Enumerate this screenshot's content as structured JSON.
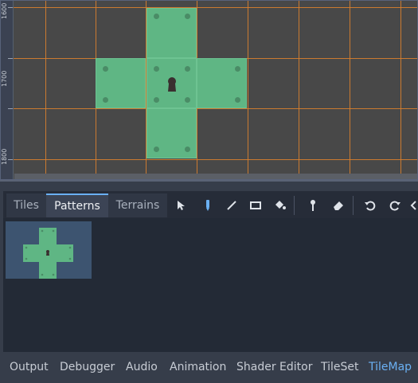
{
  "viewport": {
    "ruler_labels": [
      "1600",
      "1700",
      "1800"
    ]
  },
  "pattern_panel": {
    "tabs": [
      {
        "label": "Tiles",
        "active": false
      },
      {
        "label": "Patterns",
        "active": true
      },
      {
        "label": "Terrains",
        "active": false
      }
    ],
    "tools": [
      {
        "name": "select-tool",
        "icon": "arrow-cursor-icon"
      },
      {
        "name": "paint-tool",
        "icon": "pen-icon",
        "active": true
      },
      {
        "name": "line-tool",
        "icon": "line-icon"
      },
      {
        "name": "rect-tool",
        "icon": "rectangle-icon"
      },
      {
        "name": "bucket-tool",
        "icon": "paint-bucket-icon"
      },
      {
        "name": "picker-tool",
        "icon": "eyedropper-icon"
      },
      {
        "name": "eraser-tool",
        "icon": "eraser-icon"
      },
      {
        "name": "rotate-left-tool",
        "icon": "rotate-left-icon"
      },
      {
        "name": "rotate-right-tool",
        "icon": "rotate-right-icon"
      }
    ],
    "patterns_count": 1
  },
  "bottom_panel": {
    "tabs": [
      {
        "label": "Output",
        "active": false
      },
      {
        "label": "Debugger",
        "active": false
      },
      {
        "label": "Audio",
        "active": false
      },
      {
        "label": "Animation",
        "active": false
      },
      {
        "label": "Shader Editor",
        "active": false
      },
      {
        "label": "TileSet",
        "active": false
      },
      {
        "label": "TileMap",
        "active": true
      }
    ]
  },
  "colors": {
    "accent": "#6ab0f3",
    "tile": "#5fb684",
    "grid": "#d9802d",
    "viewport_bg": "#484848",
    "panel_bg": "#2d3442"
  }
}
